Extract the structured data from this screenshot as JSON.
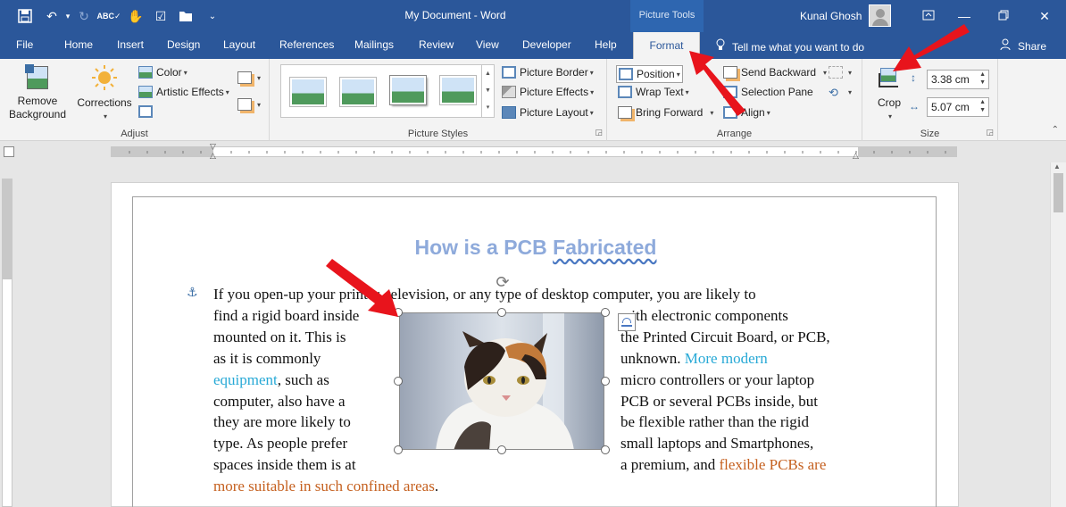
{
  "window": {
    "document_title": "My Document  -  Word",
    "context_tools": "Picture Tools",
    "user_name": "Kunal Ghosh"
  },
  "quick_access": [
    {
      "name": "save-icon",
      "glyph": "💾"
    },
    {
      "name": "undo-icon",
      "glyph": "↶"
    },
    {
      "name": "redo-icon",
      "glyph": "↻"
    },
    {
      "name": "spelling-icon",
      "glyph": "✓"
    },
    {
      "name": "touch-mode-icon",
      "glyph": "✋"
    },
    {
      "name": "check-icon",
      "glyph": "☑"
    },
    {
      "name": "folder-icon",
      "glyph": "📁"
    },
    {
      "name": "customize-icon",
      "glyph": "⌄"
    }
  ],
  "tabs": [
    "File",
    "Home",
    "Insert",
    "Design",
    "Layout",
    "References",
    "Mailings",
    "Review",
    "View",
    "Developer",
    "Help"
  ],
  "active_tab": "Format",
  "tell_me": "Tell me what you want to do",
  "share": "Share",
  "ribbon": {
    "adjust": {
      "label": "Adjust",
      "remove_background_1": "Remove",
      "remove_background_2": "Background",
      "corrections": "Corrections",
      "color": "Color",
      "artistic_effects": "Artistic Effects"
    },
    "picture_styles": {
      "label": "Picture Styles",
      "picture_border": "Picture Border",
      "picture_effects": "Picture Effects",
      "picture_layout": "Picture Layout"
    },
    "arrange": {
      "label": "Arrange",
      "position": "Position",
      "wrap_text": "Wrap Text",
      "bring_forward": "Bring Forward",
      "send_backward": "Send Backward",
      "selection_pane": "Selection Pane",
      "align": "Align"
    },
    "size": {
      "label": "Size",
      "crop": "Crop",
      "height": "3.38 cm",
      "width": "5.07 cm"
    }
  },
  "document": {
    "heading_a": "How is a PCB ",
    "heading_b": "Fabricated",
    "lines": {
      "l1": "If you open-up your printer, television, or any type of desktop computer, you are likely to",
      "l2a": "find a rigid board inside",
      "l2b": "with electronic components",
      "l3a": "mounted on it. This is",
      "l3b": "the Printed Circuit Board, or PCB,",
      "l4a": "as it is commonly",
      "l4b": "unknown. ",
      "l4c": "More modern",
      "l5a": "equipment",
      "l5b": ", such as",
      "l5c": "micro controllers or your laptop",
      "l6a": "computer, also have a",
      "l6b": "PCB or several PCBs inside, but",
      "l7a": "they are more likely to",
      "l7b": "be flexible rather than the rigid",
      "l8a": "type. As people prefer",
      "l8b": "small laptops and Smartphones,",
      "l9a": "spaces inside them is at",
      "l9b": "a premium, and ",
      "l9c": "flexible PCBs are",
      "l10a": "more suitable in such confined areas",
      "l10b": "."
    }
  },
  "colors": {
    "title_bar": "#2b579a",
    "heading": "#8eaadb",
    "link_teal": "#27a9d6",
    "link_orange": "#c5601f",
    "annotation_arrow": "#e8141c"
  }
}
